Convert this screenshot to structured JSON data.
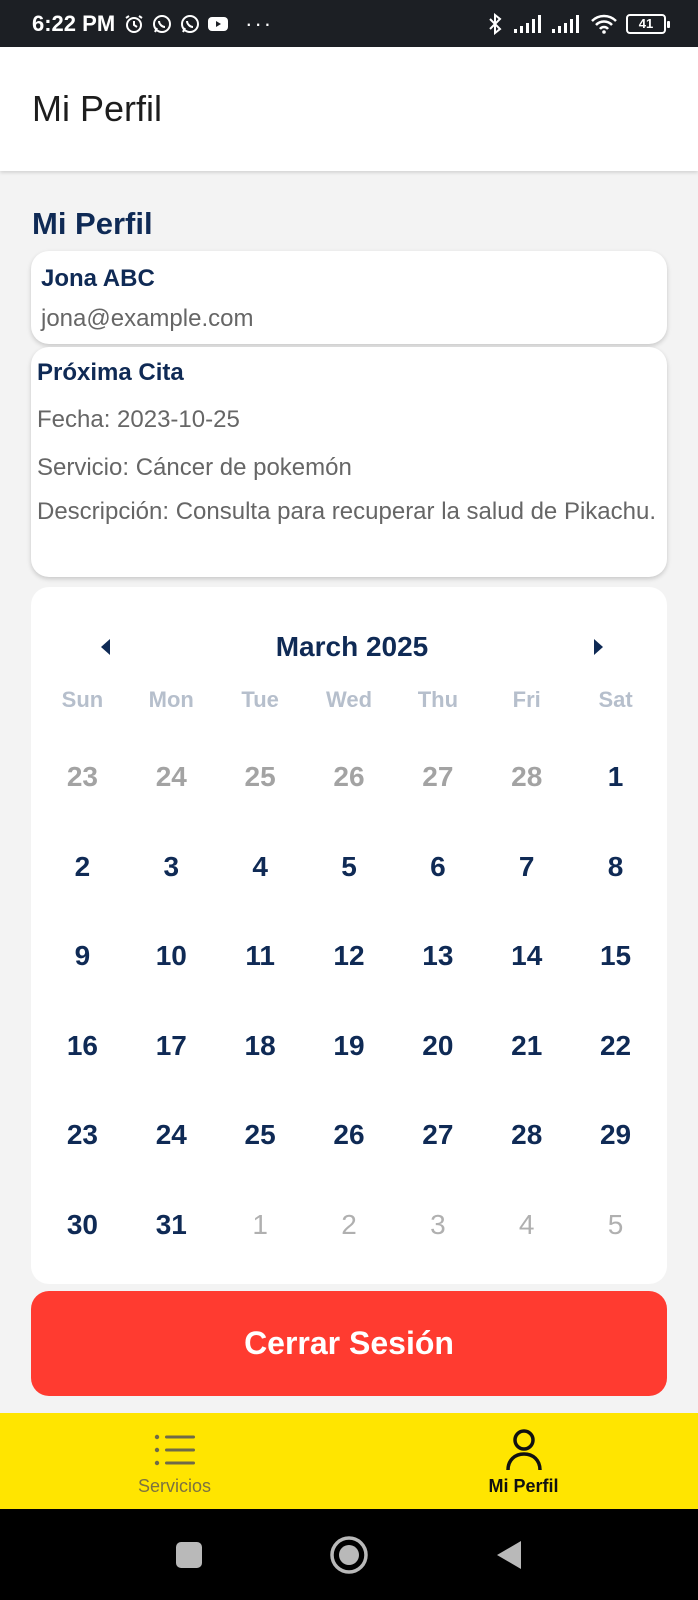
{
  "status_bar": {
    "time": "6:22 PM",
    "dots": "···",
    "battery": "41",
    "icons": [
      "alarm-icon",
      "whatsapp-icon",
      "whatsapp-icon",
      "youtube-icon",
      "bluetooth-icon",
      "signal-icon",
      "signal-icon",
      "wifi-icon",
      "battery-icon"
    ]
  },
  "app_bar": {
    "title": "Mi Perfil"
  },
  "profile": {
    "section_title": "Mi Perfil",
    "name": "Jona ABC",
    "email": "jona@example.com"
  },
  "next_appointment": {
    "heading": "Próxima Cita",
    "date": "Fecha: 2023-10-25",
    "service": "Servicio: Cáncer de pokemón",
    "description": "Descripción: Consulta para recuperar la salud de Pikachu."
  },
  "calendar": {
    "month_label": "March 2025",
    "weekdays": [
      "Sun",
      "Mon",
      "Tue",
      "Wed",
      "Thu",
      "Fri",
      "Sat"
    ],
    "days": [
      {
        "label": "23",
        "kind": "prev"
      },
      {
        "label": "24",
        "kind": "prev"
      },
      {
        "label": "25",
        "kind": "prev"
      },
      {
        "label": "26",
        "kind": "prev"
      },
      {
        "label": "27",
        "kind": "prev"
      },
      {
        "label": "28",
        "kind": "prev"
      },
      {
        "label": "1",
        "kind": "current"
      },
      {
        "label": "2",
        "kind": "current"
      },
      {
        "label": "3",
        "kind": "current"
      },
      {
        "label": "4",
        "kind": "current"
      },
      {
        "label": "5",
        "kind": "current"
      },
      {
        "label": "6",
        "kind": "current"
      },
      {
        "label": "7",
        "kind": "current"
      },
      {
        "label": "8",
        "kind": "current"
      },
      {
        "label": "9",
        "kind": "current"
      },
      {
        "label": "10",
        "kind": "current"
      },
      {
        "label": "11",
        "kind": "current"
      },
      {
        "label": "12",
        "kind": "current"
      },
      {
        "label": "13",
        "kind": "current"
      },
      {
        "label": "14",
        "kind": "current"
      },
      {
        "label": "15",
        "kind": "current"
      },
      {
        "label": "16",
        "kind": "current"
      },
      {
        "label": "17",
        "kind": "current"
      },
      {
        "label": "18",
        "kind": "current"
      },
      {
        "label": "19",
        "kind": "current"
      },
      {
        "label": "20",
        "kind": "current"
      },
      {
        "label": "21",
        "kind": "current"
      },
      {
        "label": "22",
        "kind": "current"
      },
      {
        "label": "23",
        "kind": "current"
      },
      {
        "label": "24",
        "kind": "current"
      },
      {
        "label": "25",
        "kind": "current"
      },
      {
        "label": "26",
        "kind": "current"
      },
      {
        "label": "27",
        "kind": "current"
      },
      {
        "label": "28",
        "kind": "current"
      },
      {
        "label": "29",
        "kind": "current"
      },
      {
        "label": "30",
        "kind": "current"
      },
      {
        "label": "31",
        "kind": "current"
      },
      {
        "label": "1",
        "kind": "next"
      },
      {
        "label": "2",
        "kind": "next"
      },
      {
        "label": "3",
        "kind": "next"
      },
      {
        "label": "4",
        "kind": "next"
      },
      {
        "label": "5",
        "kind": "next"
      }
    ]
  },
  "logout_button": {
    "label": "Cerrar Sesión",
    "color": "#ff3b30"
  },
  "bottom_nav": {
    "background": "#ffe500",
    "items": [
      {
        "label": "Servicios",
        "icon": "list-icon",
        "active": false
      },
      {
        "label": "Mi Perfil",
        "icon": "person-icon",
        "active": true
      }
    ]
  },
  "system_nav": {
    "buttons": [
      "recents-square-icon",
      "home-circle-icon",
      "back-triangle-icon"
    ]
  }
}
